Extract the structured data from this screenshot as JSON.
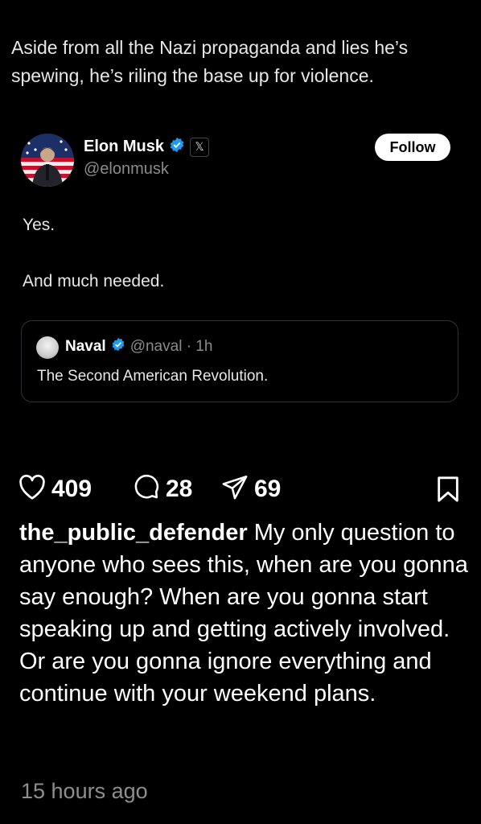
{
  "caption": "Aside from all the Nazi propaganda and lies he’s spewing, he’s riling the base up for violence.",
  "tweet": {
    "author_name": "Elon Musk",
    "author_handle": "@elonmusk",
    "follow_label": "Follow",
    "x_badge": "𝕏",
    "line1": "Yes.",
    "line2": "And much needed.",
    "quote": {
      "name": "Naval",
      "meta": "@naval · 1h",
      "text": "The Second American Revolution."
    }
  },
  "post": {
    "likes": "409",
    "comments": "28",
    "shares": "69",
    "comment_user": "the_public_defender",
    "comment_text": "My only question to anyone who sees this, when are you gonna say enough? When are you gonna start speaking up and getting actively involved. Or are you gonna ignore everything and continue with your weekend plans.",
    "timestamp": "15 hours ago"
  },
  "icons": {
    "like": "heart-icon",
    "comment": "comment-bubble-icon",
    "share": "send-icon",
    "bookmark": "bookmark-icon",
    "verified": "verified-badge-icon"
  },
  "colors": {
    "background": "#000000",
    "verified_blue": "#1d9bf0",
    "muted": "#8b8b8b"
  }
}
